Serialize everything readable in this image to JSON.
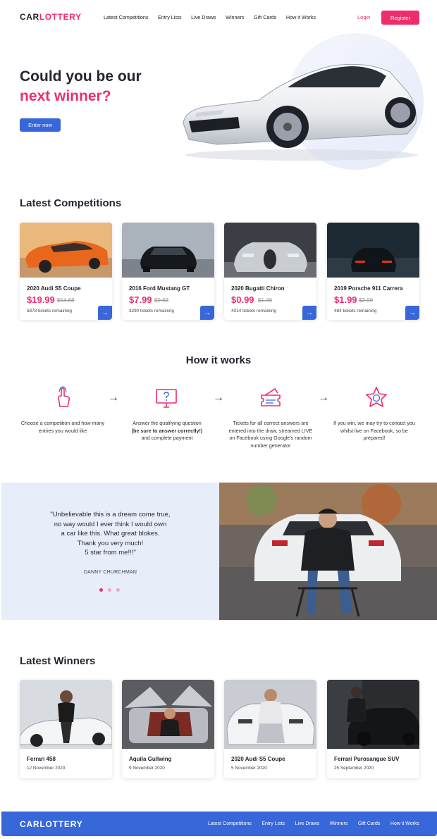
{
  "header": {
    "logo_main": "CAR",
    "logo_accent": "LOTTERY",
    "nav": [
      "Latest Competitions",
      "Entry Lists",
      "Live Draws",
      "Winners",
      "Gift Cards",
      "How it Works"
    ],
    "login": "Login",
    "register": "Register"
  },
  "hero": {
    "title_line1": "Could you be our",
    "title_line2": "next winner?",
    "cta": "Enter now"
  },
  "competitions": {
    "title": "Latest Competitions",
    "cards": [
      {
        "name": "2020 Audi S5 Coupe",
        "price": "$19.99",
        "old_price": "$54.68",
        "remaining": "5878 tickets remaining"
      },
      {
        "name": "2016 Ford Mustang GT",
        "price": "$7.99",
        "old_price": "$9.68",
        "remaining": "3290 tickets remaining"
      },
      {
        "name": "2020 Bugatti Chiron",
        "price": "$0.99",
        "old_price": "$1.39",
        "remaining": "4014 tickets remaining"
      },
      {
        "name": "2019 Porsche 911 Carrera",
        "price": "$1.99",
        "old_price": "$2.99",
        "remaining": "484 tickets remaining"
      }
    ]
  },
  "how": {
    "title": "How it works",
    "steps": [
      {
        "icon": "hand-pointer-icon",
        "text": "Choose a competition and how many entries you would like"
      },
      {
        "icon": "monitor-question-icon",
        "text_a": "Answer the qualifying question",
        "text_b": "(be sure to answer correctly!)",
        "text_c": "and complete payment"
      },
      {
        "icon": "ticket-icon",
        "text": "Tickets for all correct answers are entered into the draw, streamed LIVE on Facebook using Google's random number generator"
      },
      {
        "icon": "star-medal-icon",
        "text": "If you win, we may try to contact you whilst live on Facebook, so be prepared!"
      }
    ]
  },
  "testimonial": {
    "quote_lines": [
      "\"Unbelievable this is a dream come true,",
      "no way would I ever think I would own",
      "a car like this. What great blokes.",
      "Thank you very much!",
      "5 star from me!!!\""
    ],
    "author": "DANNY CHURCHMAN",
    "slide": "1 of 3"
  },
  "winners": {
    "title": "Latest Winners",
    "cards": [
      {
        "name": "Ferrari 458",
        "date": "12 November 2020"
      },
      {
        "name": "Aquila Gullwing",
        "date": "9 November 2020"
      },
      {
        "name": "2020 Audi S5 Coupe",
        "date": "5 November 2020"
      },
      {
        "name": "Ferrari Purosangue SUV",
        "date": "25 September 2020"
      }
    ]
  },
  "footer": {
    "logo": "CARLOTTERY",
    "nav": [
      "Latest Competitions",
      "Entry Lists",
      "Live Draws",
      "Winners",
      "Gift Cards",
      "How it Works"
    ]
  },
  "colors": {
    "accent": "#ee2e6b",
    "primary": "#3767d9"
  }
}
